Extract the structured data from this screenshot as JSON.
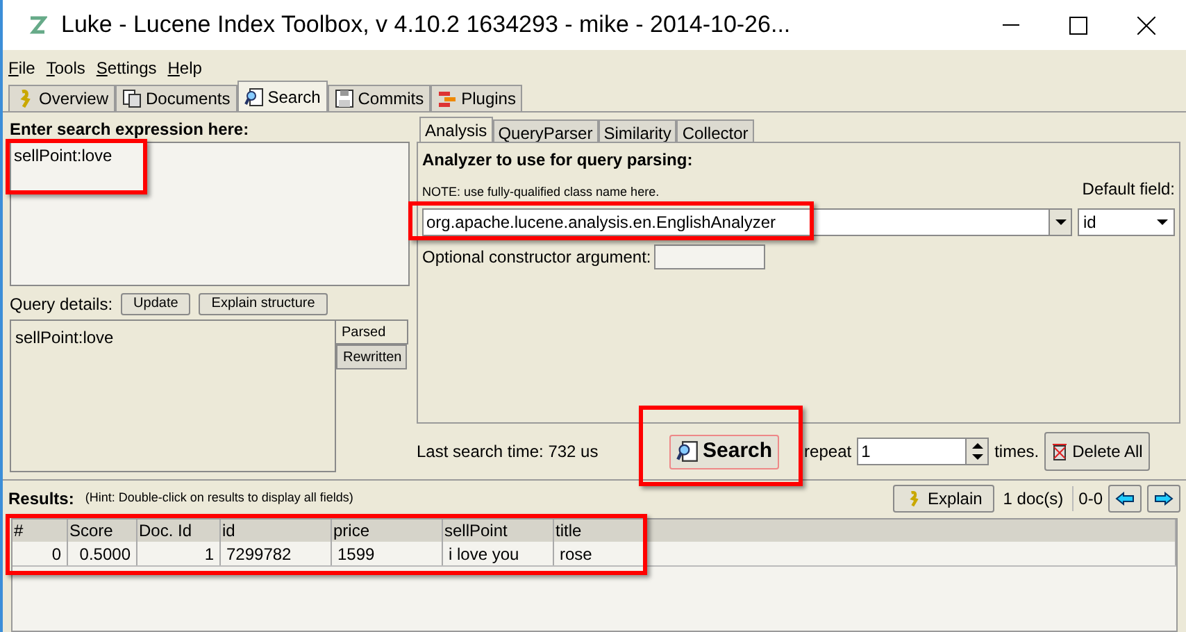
{
  "window": {
    "title": "Luke - Lucene Index Toolbox, v 4.10.2 1634293 - mike - 2014-10-26..."
  },
  "menu": [
    "File",
    "Tools",
    "Settings",
    "Help"
  ],
  "tabs": [
    {
      "label": "Overview",
      "selected": false
    },
    {
      "label": "Documents",
      "selected": false
    },
    {
      "label": "Search",
      "selected": true
    },
    {
      "label": "Commits",
      "selected": false
    },
    {
      "label": "Plugins",
      "selected": false
    }
  ],
  "search": {
    "heading": "Enter search expression here:",
    "expression": "sellPoint:love",
    "details_label": "Query details:",
    "buttons": [
      "Update",
      "Explain structure"
    ],
    "details_text": "sellPoint:love",
    "detail_tabs": [
      {
        "label": "Parsed",
        "selected": true
      },
      {
        "label": "Rewritten",
        "selected": false
      }
    ]
  },
  "analysis": {
    "tabs": [
      {
        "label": "Analysis",
        "selected": true
      },
      {
        "label": "QueryParser",
        "selected": false
      },
      {
        "label": "Similarity",
        "selected": false
      },
      {
        "label": "Collector",
        "selected": false
      }
    ],
    "heading": "Analyzer to use for query parsing:",
    "note": "NOTE: use fully-qualified class name here.",
    "default_field_label": "Default field:",
    "analyzer": "org.apache.lucene.analysis.en.EnglishAnalyzer",
    "default_field": "id",
    "constructor_label": "Optional constructor argument:"
  },
  "search_bar": {
    "last_time": "Last search time: 732 us",
    "search_button": "Search",
    "repeat_label": "repeat",
    "repeat": "1",
    "times_label": "times.",
    "delete_button": "Delete All"
  },
  "results": {
    "title": "Results:",
    "hint": "(Hint: Double-click on results to display all fields)",
    "explain_button": "Explain",
    "count": "1 doc(s)",
    "range": "0-0"
  },
  "table": {
    "columns": [
      "#",
      "Score",
      "Doc. Id",
      "id",
      "price",
      "sellPoint",
      "title"
    ],
    "rows": [
      [
        "0",
        "0.5000",
        "1",
        "7299782",
        "1599",
        "i love you",
        "rose"
      ]
    ]
  }
}
